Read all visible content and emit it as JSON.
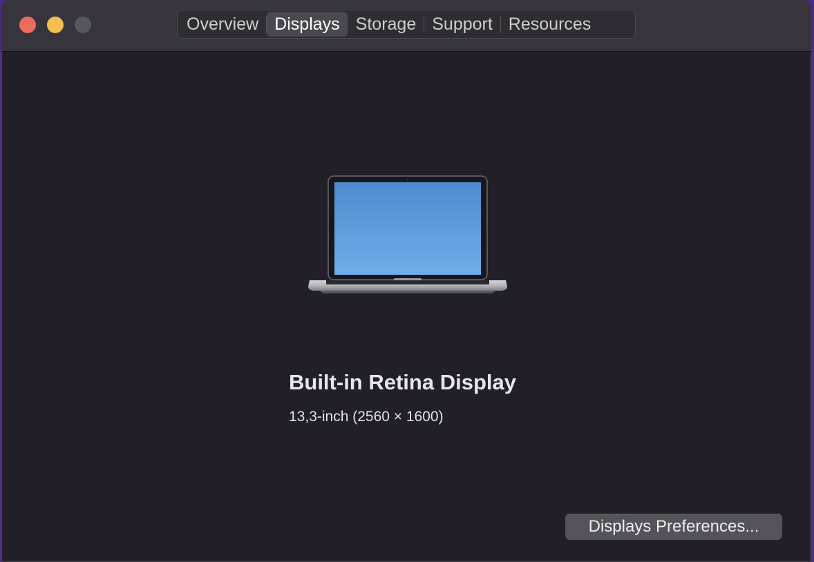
{
  "window": {
    "tabs": [
      {
        "label": "Overview",
        "active": false
      },
      {
        "label": "Displays",
        "active": true
      },
      {
        "label": "Storage",
        "active": false
      },
      {
        "label": "Support",
        "active": false
      },
      {
        "label": "Resources",
        "active": false
      }
    ]
  },
  "display": {
    "icon": "macbook-laptop-icon",
    "name": "Built-in Retina Display",
    "details": "13,3-inch (2560 × 1600)"
  },
  "actions": {
    "preferences_label": "Displays Preferences..."
  },
  "colors": {
    "close": "#ec6a5e",
    "minimize": "#f4bf4f",
    "zoom_disabled": "#58555d",
    "screen_top": "#4f8acf",
    "screen_bottom": "#6eaee8"
  }
}
